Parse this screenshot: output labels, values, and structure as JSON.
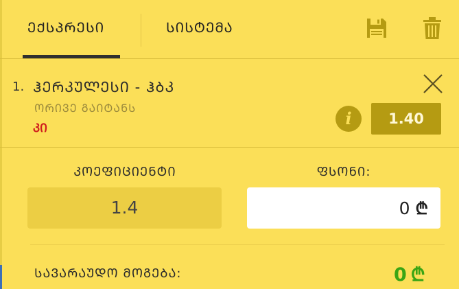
{
  "tabs": {
    "express": "ᲔᲥᲡᲞᲠᲔᲡᲘ",
    "system": "ᲡᲘᲡᲢᲔᲛᲐ"
  },
  "icons": {
    "save": "floppy-disk-icon",
    "delete": "trash-icon",
    "close": "close-icon",
    "info": "info-icon",
    "currency": "lari-sign"
  },
  "bet": {
    "index": "1.",
    "teams": "ᲰᲔᲠᲙᲣᲚᲔᲡᲘ - ᲰᲑᲙ",
    "market": "ᲝᲠᲘᲕᲔ ᲒᲐᲘᲢᲐᲜᲡ",
    "pick": "ᲙᲘ",
    "info_symbol": "i",
    "odd": "1.40"
  },
  "form": {
    "coefficient_label": "ᲙᲝᲔᲤᲘᲪᲘᲔᲜᲢᲘ",
    "coefficient_value": "1.4",
    "stake_label": "ᲤᲡᲝᲜᲘ:",
    "stake_value": "0",
    "currency_symbol": "₾"
  },
  "potential_win": {
    "label": "ᲡᲐᲕᲐᲠᲐᲣᲓᲝ ᲛᲝᲒᲔᲑᲐ:",
    "value": "0",
    "currency_symbol": "₾"
  },
  "colors": {
    "background": "#fbdf58",
    "accent_dark": "#b59b12",
    "win_green": "#3aa514",
    "pick_red": "#d01e1e"
  }
}
